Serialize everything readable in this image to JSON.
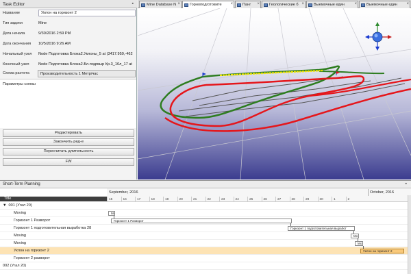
{
  "task_editor": {
    "title": "Task Editor",
    "fields": [
      {
        "label": "Название",
        "value": "Уклон на горизонт 2"
      },
      {
        "label": "Тип задачи",
        "value": "Mine"
      },
      {
        "label": "Дата начала",
        "value": "9/30/2016 2:59 PM"
      },
      {
        "label": "Дата окончания",
        "value": "10/5/2016 9:26 AM"
      },
      {
        "label": "Начальный узел",
        "value": "Node Подготовка Блока2.Уклоны_5 at (3417.959,-462"
      },
      {
        "label": "Конечный узел",
        "value": "Node Подготовка Блока2.Бл.подгвыр Кр.3_16л_17 at"
      }
    ],
    "scheme_label": "Схема расчета",
    "scheme_value": "Производительность 1 Метр/час",
    "scheme_params_label": "Параметры схемы",
    "buttons": [
      "Редактировать",
      "Закончить ред-е",
      "Пересчитать длительность",
      "FW"
    ]
  },
  "tabs": [
    {
      "label": "Mine Database N",
      "active": false
    },
    {
      "label": "Горноподготовите",
      "active": true
    },
    {
      "label": "Панг",
      "active": false
    },
    {
      "label": "Геологические б",
      "active": false
    },
    {
      "label": "Выемочные един",
      "active": false
    },
    {
      "label": "Выемочные един",
      "active": false
    }
  ],
  "viewport": {
    "accent_green": "#2e7d20",
    "accent_red": "#e5161b",
    "accent_yellow": "#f2e600",
    "navigator_icon": "orientation-gizmo-icon"
  },
  "short_term_planning": {
    "title": "Short-Term Planning",
    "column_title": "Title",
    "months": [
      "September, 2016",
      "October, 2016"
    ],
    "days": [
      "15",
      "16",
      "17",
      "18",
      "19",
      "20",
      "21",
      "22",
      "23",
      "24",
      "25",
      "26",
      "27",
      "28",
      "29",
      "30",
      "1",
      "2"
    ],
    "rows": [
      {
        "label": "001  (Уrал 20)",
        "indent": 0,
        "expander": "▼",
        "selected": false
      },
      {
        "label": "Moving",
        "indent": 2,
        "selected": false
      },
      {
        "label": "Горизонт 1 Разворот",
        "indent": 2,
        "selected": false
      },
      {
        "label": "Горизонт 1 подготовительная выработка 28",
        "indent": 2,
        "selected": false
      },
      {
        "label": "Moving",
        "indent": 2,
        "selected": false
      },
      {
        "label": "Moving",
        "indent": 2,
        "selected": false
      },
      {
        "label": "Уклон на горизонт 2",
        "indent": 2,
        "selected": true
      },
      {
        "label": "Горизонт 2 разворот",
        "indent": 2,
        "selected": false
      },
      {
        "label": "002  (Уrал 20)",
        "indent": 0,
        "expander": "",
        "selected": false
      }
    ],
    "bars": [
      {
        "label": "Mo",
        "row": 1
      },
      {
        "label": "Горизонт 1 Разворот",
        "row": 2
      },
      {
        "label": "Горизонт 1 подготовительная выработ",
        "row": 3
      },
      {
        "label": "Mo",
        "row": 4
      },
      {
        "label": "Mo",
        "row": 5
      },
      {
        "label": "Уклон на горизонт 2",
        "row": 6
      }
    ]
  }
}
